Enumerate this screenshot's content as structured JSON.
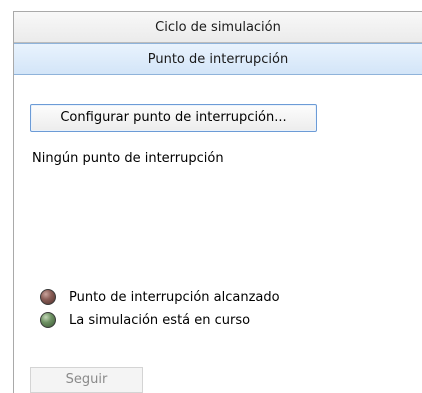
{
  "panel": {
    "sim_cycle_header": "Ciclo de simulación",
    "breakpoint_header": "Punto de interrupción"
  },
  "breakpoint": {
    "configure_button": "Configurar punto de interrupción...",
    "status_text": "Ningún punto de interrupción",
    "continue_button": "Seguir"
  },
  "legend": {
    "items": [
      {
        "icon": "brown-status-dot-icon",
        "color": "#7a4f48",
        "label": "Punto de interrupción alcanzado"
      },
      {
        "icon": "green-status-dot-icon",
        "color": "#5f8a55",
        "label": "La simulación está en curso"
      }
    ]
  }
}
